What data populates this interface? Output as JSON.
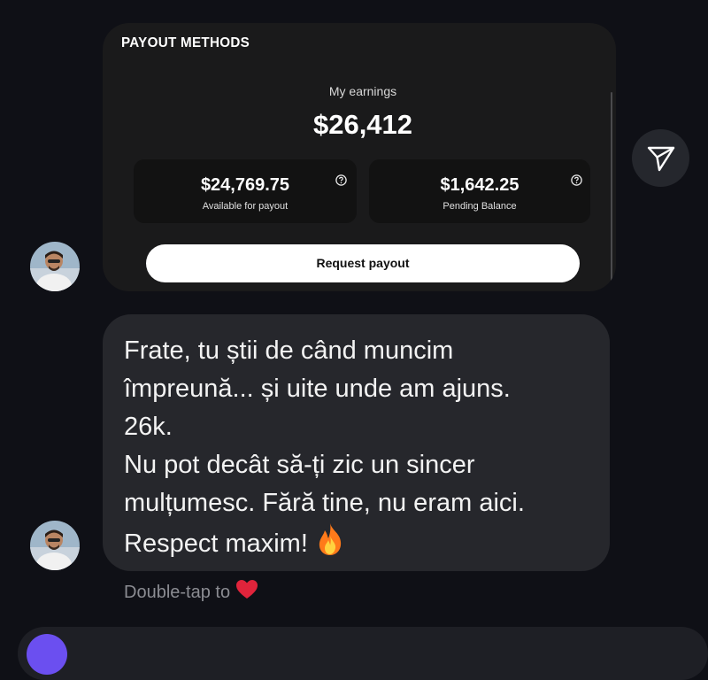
{
  "card": {
    "title": "PAYOUT METHODS",
    "earnings_label": "My earnings",
    "earnings_value": "$26,412",
    "available": {
      "value": "$24,769.75",
      "label": "Available for payout"
    },
    "pending": {
      "value": "$1,642.25",
      "label": "Pending Balance"
    },
    "request_button": "Request payout"
  },
  "message": {
    "lines": [
      "Frate, tu știi de când muncim",
      "împreună... și uite unde am ajuns.",
      "26k.",
      "Nu pot decât să-ți zic un sincer",
      "mulțumesc. Fără tine, nu eram aici.",
      "Respect maxim!"
    ],
    "emoji": "fire-emoji"
  },
  "hint": {
    "text": "Double-tap to",
    "icon": "heart-icon"
  },
  "icons": {
    "share": "send-icon",
    "help": "question-circle-icon"
  },
  "colors": {
    "background": "#0f1016",
    "card": "#1a1a1b",
    "bubble": "#26272c",
    "accent": "#6b4ff0",
    "heart": "#e0243b"
  }
}
